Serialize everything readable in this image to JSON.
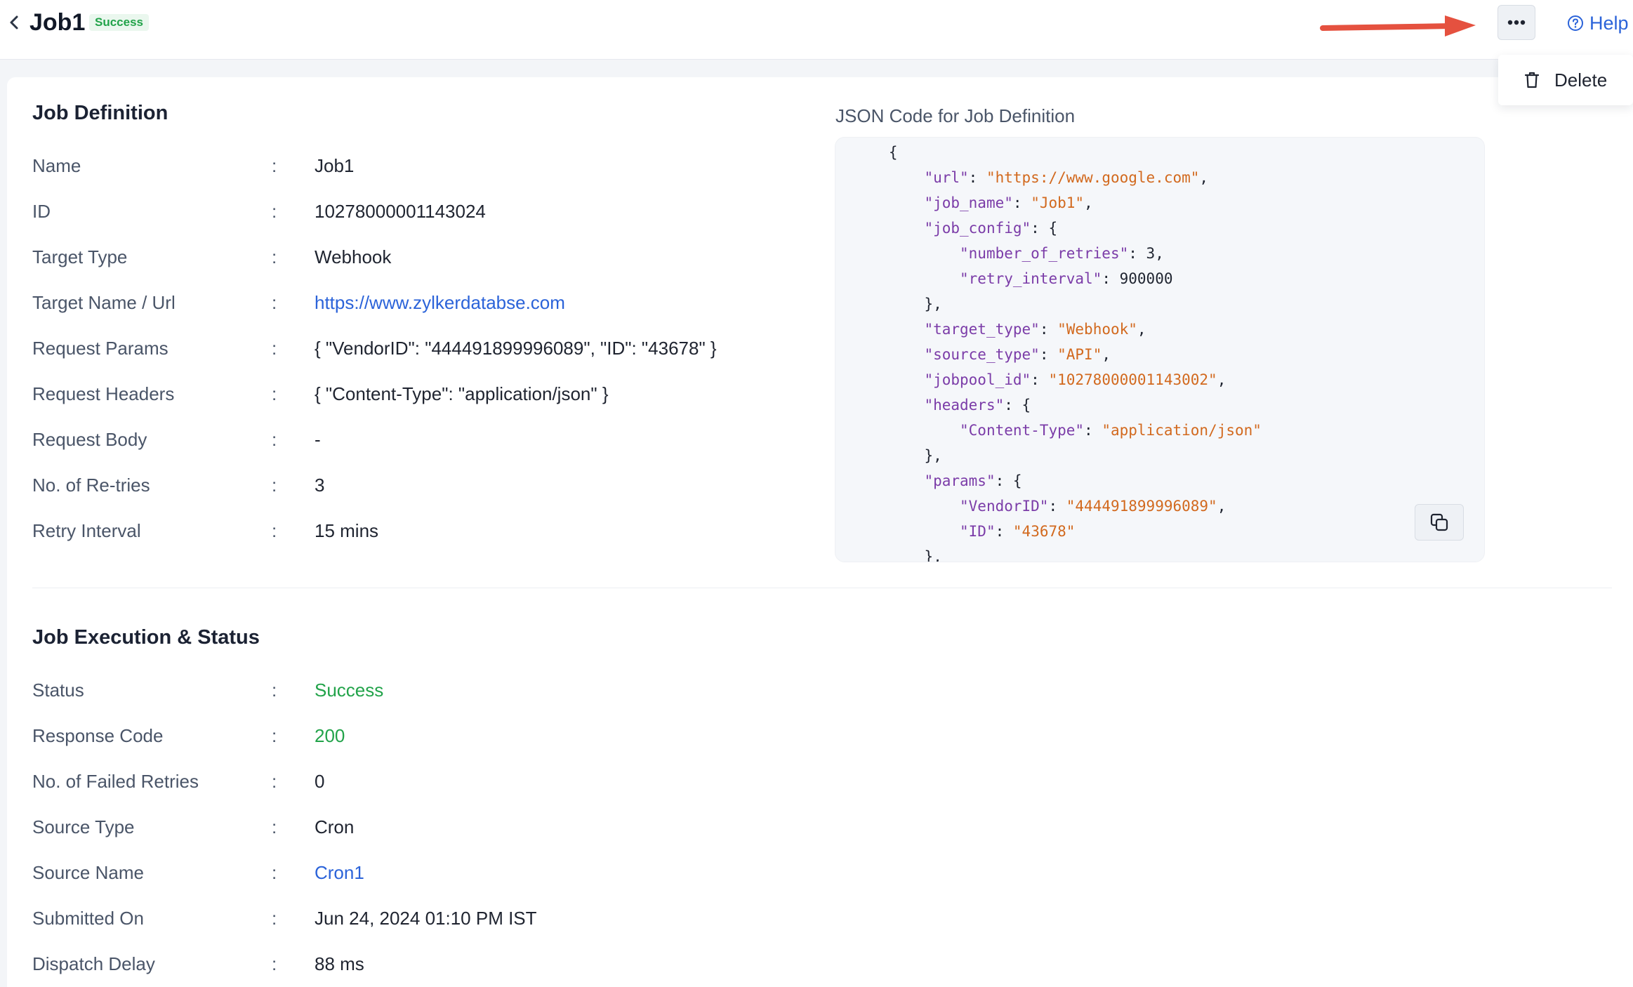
{
  "header": {
    "title": "Job1",
    "status_badge": "Success",
    "help_label": "Help"
  },
  "menu": {
    "items": [
      {
        "label": "Delete",
        "icon": "trash-icon"
      }
    ]
  },
  "job_definition": {
    "title": "Job Definition",
    "rows": [
      {
        "key": "Name",
        "value": "Job1"
      },
      {
        "key": "ID",
        "value": "10278000001143024"
      },
      {
        "key": "Target Type",
        "value": "Webhook"
      },
      {
        "key": "Target Name / Url",
        "value": "https://www.zylkerdatabse.com"
      },
      {
        "key": "Request Params",
        "value": "{ \"VendorID\": \"444491899996089\", \"ID\": \"43678\" }"
      },
      {
        "key": "Request Headers",
        "value": "{ \"Content-Type\": \"application/json\" }"
      },
      {
        "key": "Request Body",
        "value": "-"
      },
      {
        "key": "No. of Re-tries",
        "value": "3"
      },
      {
        "key": "Retry Interval",
        "value": "15 mins"
      }
    ]
  },
  "json_code": {
    "title": "JSON Code for Job Definition",
    "lines": [
      "{",
      "    \"url\": \"https://www.google.com\",",
      "    \"job_name\": \"Job1\",",
      "    \"job_config\": {",
      "        \"number_of_retries\": 3,",
      "        \"retry_interval\": 900000",
      "    },",
      "    \"target_type\": \"Webhook\",",
      "    \"source_type\": \"API\",",
      "    \"jobpool_id\": \"10278000001143002\",",
      "    \"headers\": {",
      "        \"Content-Type\": \"application/json\"",
      "    },",
      "    \"params\": {",
      "        \"VendorID\": \"444491899996089\",",
      "        \"ID\": \"43678\"",
      "    },"
    ]
  },
  "job_execution": {
    "title": "Job Execution & Status",
    "rows": [
      {
        "key": "Status",
        "value": "Success"
      },
      {
        "key": "Response Code",
        "value": "200"
      },
      {
        "key": "No. of Failed Retries",
        "value": "0"
      },
      {
        "key": "Source Type",
        "value": "Cron"
      },
      {
        "key": "Source Name",
        "value": "Cron1"
      },
      {
        "key": "Submitted On",
        "value": "Jun 24, 2024 01:10 PM IST"
      },
      {
        "key": "Dispatch Delay",
        "value": "88 ms"
      }
    ]
  },
  "separator": ":",
  "colors": {
    "success": "#22a34a",
    "link": "#2b63d9",
    "json_key": "#7b3ca8",
    "json_string": "#d2691e",
    "annotation_arrow": "#e5513f"
  }
}
